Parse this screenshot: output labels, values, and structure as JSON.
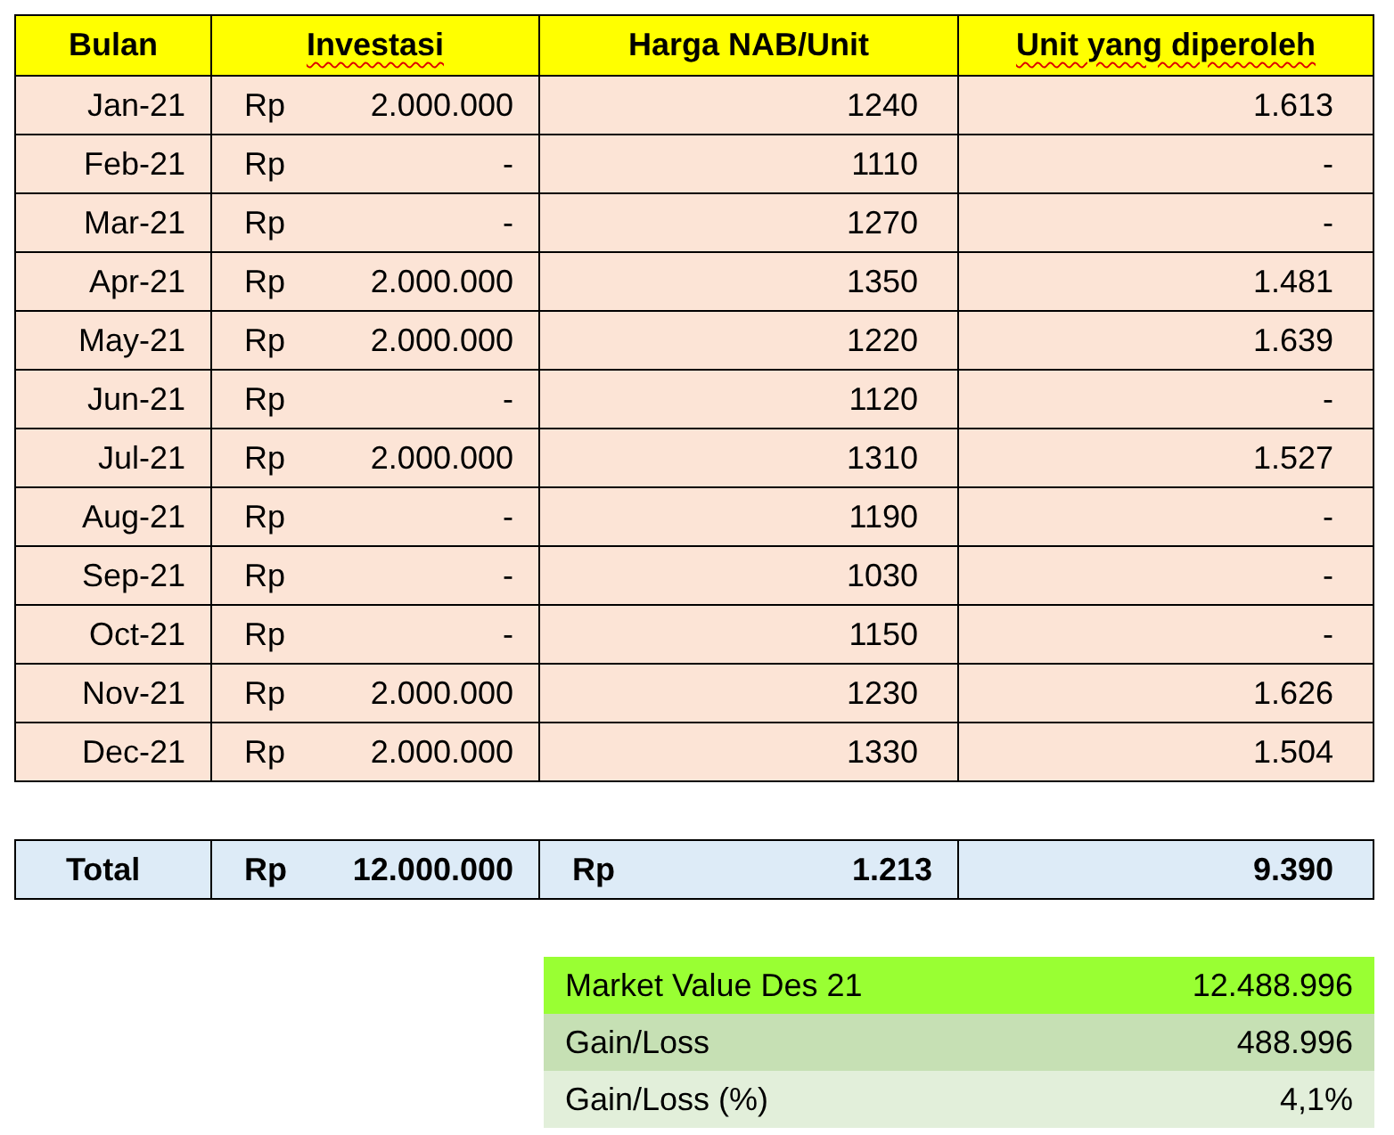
{
  "headers": [
    {
      "label": "Bulan",
      "misspelled": false
    },
    {
      "label": "Investasi",
      "misspelled": true
    },
    {
      "label": "Harga NAB/Unit",
      "misspelled": false
    },
    {
      "label": "Unit yang diperoleh",
      "misspelled": true
    }
  ],
  "rows": [
    {
      "month": "Jan-21",
      "currency": "Rp",
      "amount": "2.000.000",
      "price": "1240",
      "units": "1.613"
    },
    {
      "month": "Feb-21",
      "currency": "Rp",
      "amount": "-",
      "price": "1110",
      "units": "-"
    },
    {
      "month": "Mar-21",
      "currency": "Rp",
      "amount": "-",
      "price": "1270",
      "units": "-"
    },
    {
      "month": "Apr-21",
      "currency": "Rp",
      "amount": "2.000.000",
      "price": "1350",
      "units": "1.481"
    },
    {
      "month": "May-21",
      "currency": "Rp",
      "amount": "2.000.000",
      "price": "1220",
      "units": "1.639"
    },
    {
      "month": "Jun-21",
      "currency": "Rp",
      "amount": "-",
      "price": "1120",
      "units": "-"
    },
    {
      "month": "Jul-21",
      "currency": "Rp",
      "amount": "2.000.000",
      "price": "1310",
      "units": "1.527"
    },
    {
      "month": "Aug-21",
      "currency": "Rp",
      "amount": "-",
      "price": "1190",
      "units": "-"
    },
    {
      "month": "Sep-21",
      "currency": "Rp",
      "amount": "-",
      "price": "1030",
      "units": "-"
    },
    {
      "month": "Oct-21",
      "currency": "Rp",
      "amount": "-",
      "price": "1150",
      "units": "-"
    },
    {
      "month": "Nov-21",
      "currency": "Rp",
      "amount": "2.000.000",
      "price": "1230",
      "units": "1.626"
    },
    {
      "month": "Dec-21",
      "currency": "Rp",
      "amount": "2.000.000",
      "price": "1330",
      "units": "1.504"
    }
  ],
  "total": {
    "label": "Total",
    "currency": "Rp",
    "amount": "12.000.000",
    "price_currency": "Rp",
    "price": "1.213",
    "units": "9.390"
  },
  "summary": [
    {
      "label": "Market Value Des 21",
      "value": "12.488.996",
      "color": "#99ff33"
    },
    {
      "label": "Gain/Loss",
      "value": "488.996",
      "color": "#c6e0b4"
    },
    {
      "label": "Gain/Loss (%)",
      "value": "4,1%",
      "color": "#e2efda"
    }
  ]
}
